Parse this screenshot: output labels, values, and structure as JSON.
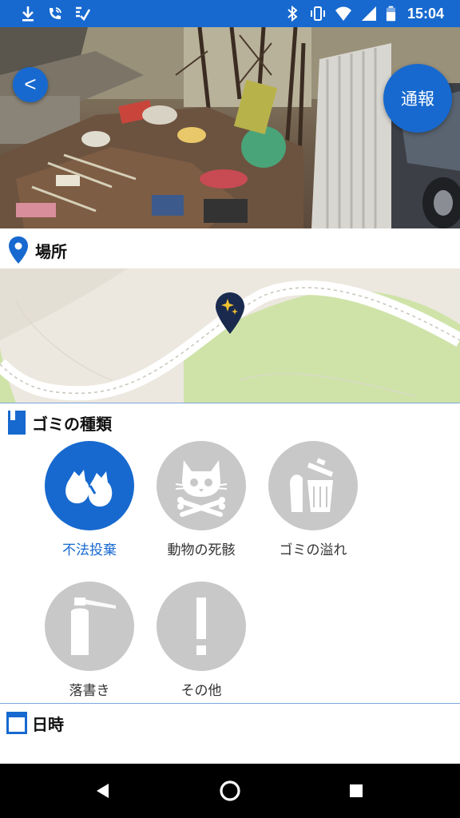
{
  "status_bar": {
    "time": "15:04",
    "left_icons": [
      "download-icon",
      "wifi-call-icon",
      "checklist-icon"
    ],
    "right_icons": [
      "bluetooth-icon",
      "vibrate-icon",
      "wifi-icon",
      "signal-icon",
      "battery-icon"
    ]
  },
  "header": {
    "back_label": "<",
    "report_label": "通報"
  },
  "location_section": {
    "title": "場所",
    "icon": "location-pin-icon"
  },
  "map": {
    "marker_icon": "sparkle-marker-icon"
  },
  "garbage_type_section": {
    "title": "ゴミの種類",
    "icon": "bookmark-icon",
    "items": [
      {
        "label": "不法投棄",
        "icon": "garbage-bags-icon",
        "selected": true
      },
      {
        "label": "動物の死骸",
        "icon": "cat-skull-crossbones-icon",
        "selected": false
      },
      {
        "label": "ゴミの溢れ",
        "icon": "overflowing-trash-can-icon",
        "selected": false
      },
      {
        "label": "落書き",
        "icon": "spray-can-icon",
        "selected": false
      },
      {
        "label": "その他",
        "icon": "exclamation-icon",
        "selected": false
      }
    ]
  },
  "datetime_section": {
    "title": "日時",
    "icon": "calendar-icon"
  },
  "colors": {
    "accent": "#1769cf",
    "inactive_circle": "#c8c8c8",
    "map_green": "#cfe3a9",
    "map_bg": "#ece8df",
    "navbar": "#000000"
  },
  "nav_bar": {
    "buttons": [
      "back-triangle-icon",
      "home-circle-icon",
      "recents-square-icon"
    ]
  }
}
